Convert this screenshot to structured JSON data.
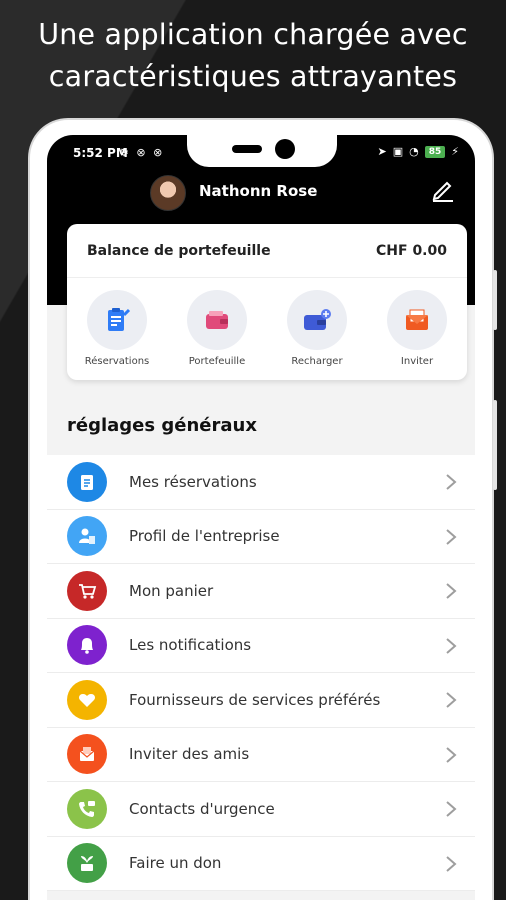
{
  "headline": {
    "line1": "Une application chargée avec",
    "line2": "caractéristiques attrayantes"
  },
  "status_bar": {
    "time": "5:52 PM",
    "battery": "85"
  },
  "header": {
    "user_name": "Nathonn Rose"
  },
  "wallet_card": {
    "label": "Balance de portefeuille",
    "amount": "CHF 0.00",
    "actions": [
      {
        "label": "Réservations",
        "icon": "reservations-icon",
        "color": "#2f7cf6"
      },
      {
        "label": "Portefeuille",
        "icon": "wallet-icon",
        "color": "#e04a7a"
      },
      {
        "label": "Recharger",
        "icon": "recharge-wallet-icon",
        "color": "#3f5bd6"
      },
      {
        "label": "Inviter",
        "icon": "invite-envelope-icon",
        "color": "#f05a22"
      }
    ]
  },
  "settings": {
    "title": "réglages généraux",
    "items": [
      {
        "label": "Mes réservations",
        "icon": "clipboard-icon",
        "color": "#1e88e5"
      },
      {
        "label": "Profil de l'entreprise",
        "icon": "company-profile-icon",
        "color": "#42a5f5"
      },
      {
        "label": "Mon panier",
        "icon": "cart-icon",
        "color": "#c62828"
      },
      {
        "label": "Les notifications",
        "icon": "bell-icon",
        "color": "#7e22ce"
      },
      {
        "label": "Fournisseurs de services préférés",
        "icon": "heart-icon",
        "color": "#f4b400"
      },
      {
        "label": "Inviter des amis",
        "icon": "invite-icon",
        "color": "#f4511e"
      },
      {
        "label": "Contacts d'urgence",
        "icon": "phone-icon",
        "color": "#8bc34a"
      },
      {
        "label": "Faire un don",
        "icon": "donate-icon",
        "color": "#43a047"
      }
    ]
  }
}
